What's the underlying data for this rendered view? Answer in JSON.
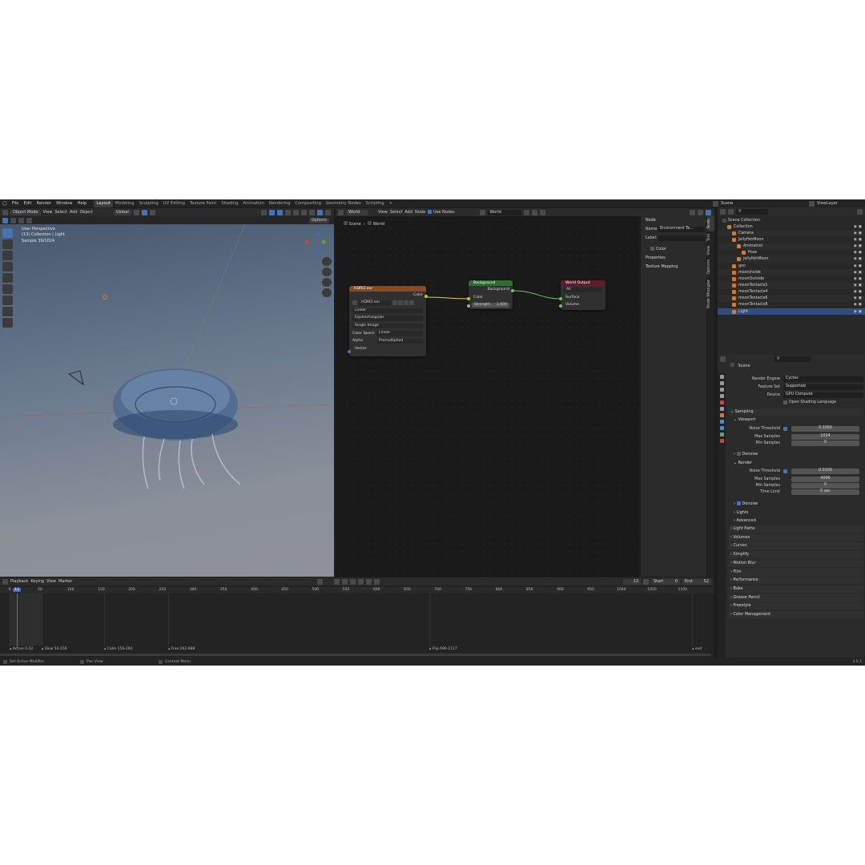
{
  "menus": [
    "File",
    "Edit",
    "Render",
    "Window",
    "Help"
  ],
  "workspaces": [
    "Layout",
    "Modeling",
    "Sculpting",
    "UV Editing",
    "Texture Paint",
    "Shading",
    "Animation",
    "Rendering",
    "Compositing",
    "Geometry Nodes",
    "Scripting"
  ],
  "active_workspace": "Layout",
  "top_right": {
    "scene": "Scene",
    "view_layer": "ViewLayer"
  },
  "viewport": {
    "mode": "Object Mode",
    "menus": [
      "View",
      "Select",
      "Add",
      "Object"
    ],
    "orientation": "Global",
    "options": "Options",
    "info_lines": [
      "User Perspective",
      "(13) Collection | Light",
      "Sample 39/1024"
    ]
  },
  "node_editor": {
    "type": "World",
    "menus": [
      "View",
      "Select",
      "Add",
      "Node"
    ],
    "use_nodes_label": "Use Nodes",
    "world_name": "World",
    "breadcrumb": [
      "Scene",
      "World"
    ],
    "env_node": {
      "title": "HDRI2.exr",
      "output": "Color",
      "image": "HDRI2.exr",
      "interpolation": "Linear",
      "projection": "Equirectangular",
      "source": "Single Image",
      "color_space_label": "Color Space",
      "color_space": "Linear",
      "alpha_label": "Alpha",
      "alpha": "Premultiplied",
      "input": "Vector"
    },
    "bg_node": {
      "title": "Background",
      "output": "Background",
      "color": "Color",
      "strength_label": "Strength",
      "strength": "1.000"
    },
    "out_node": {
      "title": "World Output",
      "target": "All",
      "surface": "Surface",
      "volume": "Volume"
    },
    "colors": {
      "env_header": "#8a4a1b",
      "bg_header": "#2f6b32",
      "out_header": "#5a1f2a",
      "link_yellow": "#d6d63a",
      "link_green": "#63c763"
    }
  },
  "n_panel": {
    "title": "Node",
    "name_label": "Name:",
    "name_value": "Environment Te...",
    "label_label": "Label:",
    "color": "Color",
    "properties": "Properties",
    "texture_mapping": "Texture Mapping",
    "tabs": [
      "Node",
      "Tool",
      "View",
      "Options",
      "Node Wrangler"
    ]
  },
  "outliner": {
    "title": "Scene Collection",
    "items": [
      {
        "name": "Collection",
        "indent": 1
      },
      {
        "name": "Camera",
        "indent": 2
      },
      {
        "name": "JellyfishMoon",
        "indent": 2
      },
      {
        "name": "Animation",
        "indent": 3
      },
      {
        "name": "Pose",
        "indent": 4
      },
      {
        "name": "jellyfishMoon",
        "indent": 3
      },
      {
        "name": "goo",
        "indent": 2
      },
      {
        "name": "moonInside",
        "indent": 2
      },
      {
        "name": "moonOutside",
        "indent": 2
      },
      {
        "name": "moonTentacle1",
        "indent": 2
      },
      {
        "name": "moonTentacle4",
        "indent": 2
      },
      {
        "name": "moonTentacle6",
        "indent": 2
      },
      {
        "name": "moonTentacle8",
        "indent": 2
      },
      {
        "name": "Light",
        "indent": 2
      }
    ],
    "selected": "Light"
  },
  "properties": {
    "context": "Scene",
    "render_engine_label": "Render Engine",
    "render_engine": "Cycles",
    "feature_set_label": "Feature Set",
    "feature_set": "Supported",
    "device_label": "Device",
    "device": "GPU Compute",
    "osl": "Open Shading Language",
    "sampling": "Sampling",
    "viewport": "Viewport",
    "vp_noise_label": "Noise Threshold",
    "vp_noise": "0.1000",
    "vp_max_label": "Max Samples",
    "vp_max": "1024",
    "vp_min_label": "Min Samples",
    "vp_min": "0",
    "denoise": "Denoise",
    "render": "Render",
    "r_noise_label": "Noise Threshold",
    "r_noise": "0.0100",
    "r_max_label": "Max Samples",
    "r_max": "4096",
    "r_min_label": "Min Samples",
    "r_min": "0",
    "time_limit_label": "Time Limit",
    "time_limit": "0 sec",
    "denoise2": "Denoise",
    "lights": "Lights",
    "advanced": "Advanced",
    "sections": [
      "Light Paths",
      "Volumes",
      "Curves",
      "Simplify",
      "Motion Blur",
      "Film",
      "Performance",
      "Bake",
      "Grease Pencil",
      "Freestyle",
      "Color Management"
    ]
  },
  "timeline": {
    "menus": [
      "Playback",
      "Keying",
      "View",
      "Marker"
    ],
    "current_frame": "13",
    "start_label": "Start",
    "start": "0",
    "end_label": "End",
    "end": "52",
    "ruler_first": "0",
    "ticks": [
      "50",
      "100",
      "150",
      "200",
      "250",
      "300",
      "350",
      "400",
      "450",
      "500",
      "550",
      "600",
      "650",
      "700",
      "750",
      "800",
      "850",
      "900",
      "950",
      "1000",
      "1050",
      "1100"
    ],
    "markers": [
      "Active 0-52",
      "Slow 54-156",
      "Calm 158-260",
      "Free 262-688",
      "Flip 690-1117",
      "end"
    ]
  },
  "status": {
    "left": "Set Active Modifier",
    "middle": "Pan View",
    "right": "Context Menu",
    "version": "3.5.1"
  }
}
